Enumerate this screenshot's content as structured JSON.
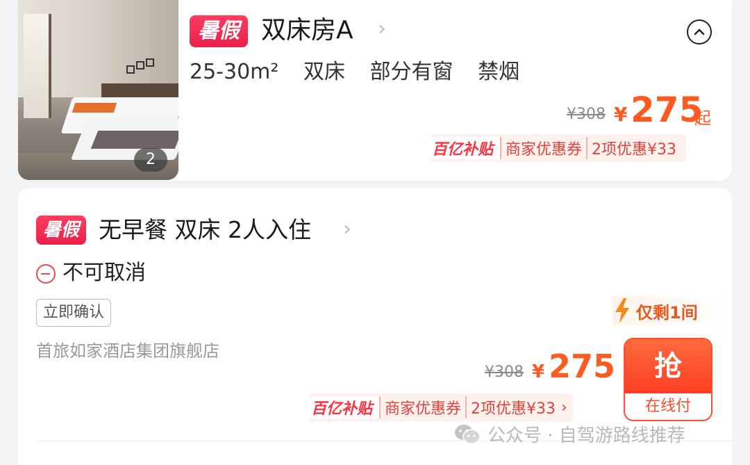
{
  "room": {
    "tag": "暑假",
    "title": "双床房A",
    "photo_count": "2",
    "attributes": [
      "25-30m²",
      "双床",
      "部分有窗",
      "禁烟"
    ],
    "original_price": "¥308",
    "currency": "¥",
    "price": "275",
    "price_suffix": "起",
    "promo": {
      "brand": "百亿补贴",
      "coupon": "商家优惠券",
      "discount": "2项优惠¥33"
    }
  },
  "plan": {
    "tag": "暑假",
    "title": "无早餐 双床 2人入住",
    "cancel_policy": "不可取消",
    "confirm_tag": "立即确认",
    "store": "首旅如家酒店集团旗舰店",
    "stock": "仅剩1间",
    "original_price": "¥308",
    "currency": "¥",
    "price": "275",
    "book_label": "抢",
    "pay_label": "在线付",
    "promo": {
      "brand": "百亿补贴",
      "coupon": "商家优惠券",
      "discount": "2项优惠¥33",
      "arrow": "›"
    }
  },
  "watermark": "公众号 · 自驾游路线推荐",
  "colors": {
    "accent": "#ff5a1f",
    "tag_red": "#e8204a",
    "promo_red": "#e0433a"
  }
}
